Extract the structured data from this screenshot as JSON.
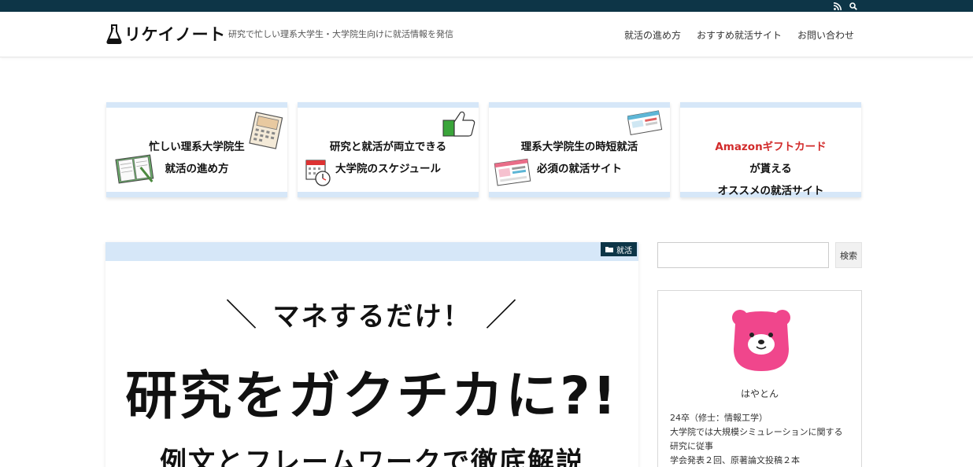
{
  "topbar": {
    "icons": [
      "rss-icon",
      "search-icon"
    ]
  },
  "header": {
    "logo_text": "リケイノート",
    "tagline": "研究で忙しい理系大学生・大学院生向けに就活情報を発信",
    "nav": [
      "就活の進め方",
      "おすすめ就活サイト",
      "お問い合わせ"
    ]
  },
  "cards": [
    {
      "line1": "忙しい理系大学院生",
      "line2": "就活の進め方"
    },
    {
      "line1": "研究と就活が両立できる",
      "line2": "大学院のスケジュール"
    },
    {
      "line1": "理系大学院生の時短就活",
      "line2": "必須の就活サイト"
    },
    {
      "line1_accent": "Amazonギフトカード",
      "line1_rest": "が貰える",
      "line2": "オススメの就活サイト"
    }
  ],
  "article": {
    "category": "就活",
    "eyebrow": "マネするだけ！",
    "eyebrow_left": "＼",
    "eyebrow_right": "／",
    "title": "研究をガクチカに?!",
    "subtitle": "例文とフレームワークで徹底解説"
  },
  "sidebar": {
    "search_button": "検索",
    "profile_name": "はやとん",
    "bio": [
      "24卒（修士：情報工学）",
      "大学院では大規模シミュレーションに関する",
      "研究に従事",
      "学会発表２回、原著論文投稿２本"
    ]
  },
  "colors": {
    "topbar": "#0d3547",
    "card_band": "#d6e7f8",
    "accent_red": "#d22b2b",
    "avatar_pink": "#f0468c"
  }
}
